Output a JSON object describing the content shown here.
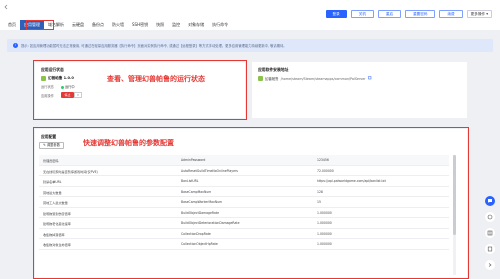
{
  "nav": {
    "tabs": [
      "首页",
      "应用管理",
      "域名解析",
      "云硬盘",
      "备份点",
      "防火墙",
      "SSH密钥",
      "快照",
      "监控",
      "对象存储",
      "执行命令"
    ],
    "active_index": 1
  },
  "header_actions": {
    "primary": "登录",
    "restart": "关机",
    "reset": "重启",
    "rebuild": "重置密码",
    "more": "续费",
    "dropdown": "更多操作"
  },
  "notice": {
    "text": "提示: 如应用管理功能暂时无法正常使用, 可通过在轻量应用服务器【执行命令】页面对实例执行命令, 或通过【远程登录】等方式手动处理。更多应用管理能力持续更新中, 敬请期待。"
  },
  "app_status": {
    "title": "应用运行状态",
    "app_name": "幻兽帕鲁 1.0.0",
    "status_label": "运行状态",
    "status_value": "运行中",
    "ops_label": "应用操作",
    "stop_label": "停止",
    "more_label": "▾",
    "annotation": "查看、管理幻兽帕鲁的运行状态"
  },
  "app_path": {
    "title": "应用软件安装地址",
    "label": "幻兽帕鲁",
    "value": "/home/steam/Steam/steamapps/common/PalServer"
  },
  "settings": {
    "title": "应用配置",
    "adjust_label": "调整参数",
    "annotation": "快速调整幻兽帕鲁的参数配置",
    "rows": [
      [
        "管理员密码",
        "AdminPassword",
        "123456"
      ],
      [
        "无在线玩家时是否暂停游戏时间(仅PVE)",
        "AutoResetGuildTimeNoOnlinePlayers",
        "72.000000"
      ],
      [
        "封禁名单URL",
        "BanListURL",
        "https://api.palworldgame.com/api/banlist.txt"
      ],
      [
        "营地最大数量",
        "BaseCampMaxNum",
        "128"
      ],
      [
        "营地工人最大数量",
        "BaseCampWorkerMaxNum",
        "15"
      ],
      [
        "建筑物受到伤害倍率",
        "BuildObjectDamageRate",
        "1.000000"
      ],
      [
        "建筑物老化恶化速率",
        "BuildObjectDeteriorationDamageRate",
        "1.000000"
      ],
      [
        "收集物掉落倍率",
        "CollectionDropRate",
        "1.000000"
      ],
      [
        "收集物对象生命倍率",
        "CollectionObjectHpRate",
        "1.000000"
      ]
    ]
  },
  "colors": {
    "brand_blue": "#2962ff",
    "annotation_red": "#e53935",
    "running_green": "#2ecc71"
  }
}
